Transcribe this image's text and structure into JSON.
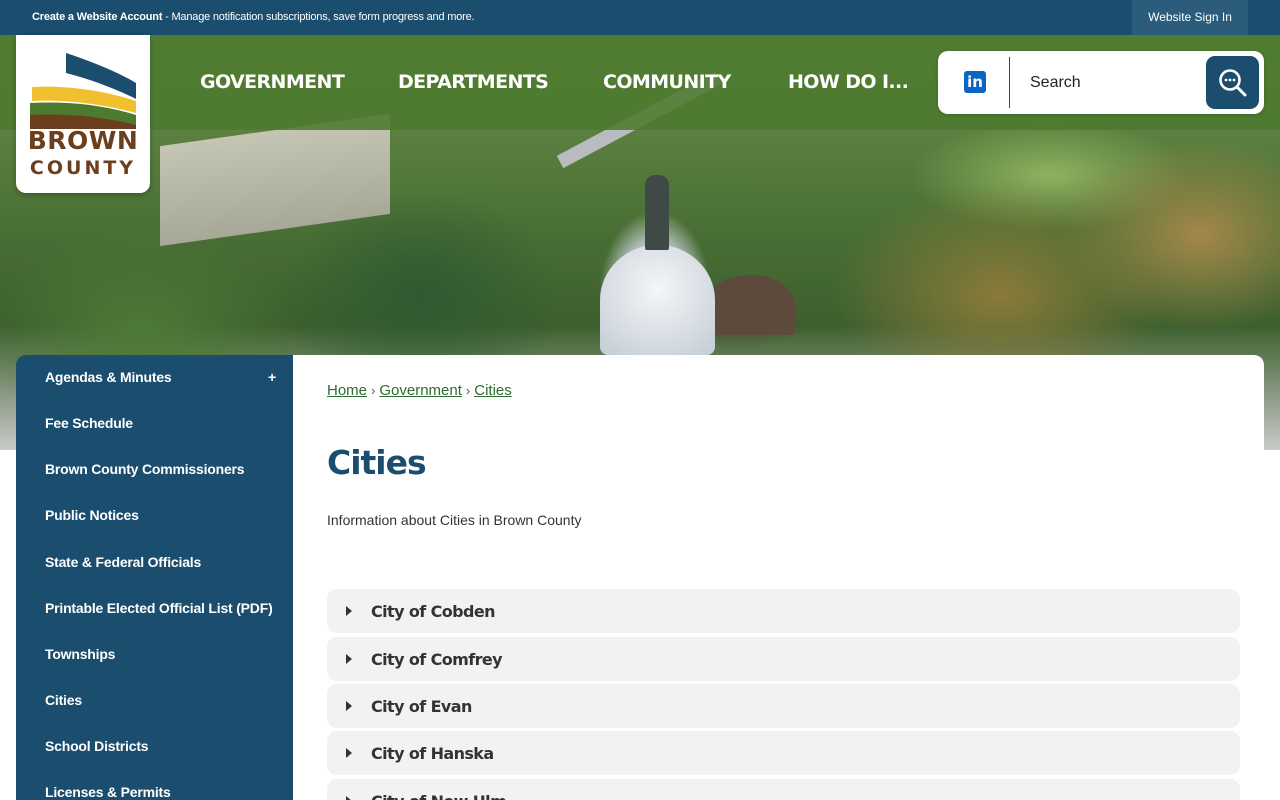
{
  "topbar": {
    "create_account": "Create a Website Account",
    "message": " - Manage notification subscriptions, save form progress and more.",
    "signin_label": "Website Sign In"
  },
  "logo": {
    "line1": "BROWN",
    "line2": "COUNTY",
    "colors": {
      "navy": "#1a4d6e",
      "gold": "#f0c030",
      "green": "#4c7a2f",
      "brown": "#6b3f1d"
    }
  },
  "nav": {
    "items": [
      {
        "label": "GOVERNMENT"
      },
      {
        "label": "DEPARTMENTS"
      },
      {
        "label": "COMMUNITY"
      },
      {
        "label": "HOW DO I..."
      }
    ]
  },
  "search": {
    "placeholder": "Search",
    "social_icon": "linkedin-icon",
    "button_icon": "search-icon"
  },
  "sidebar": {
    "items": [
      {
        "label": "Agendas & Minutes",
        "expand": "+"
      },
      {
        "label": "Fee Schedule"
      },
      {
        "label": "Brown County Commissioners"
      },
      {
        "label": "Public Notices"
      },
      {
        "label": "State & Federal Officials"
      },
      {
        "label": "Printable Elected Official List (PDF)"
      },
      {
        "label": "Townships"
      },
      {
        "label": "Cities"
      },
      {
        "label": "School Districts"
      },
      {
        "label": "Licenses & Permits"
      }
    ]
  },
  "breadcrumb": {
    "items": [
      "Home",
      "Government",
      "Cities"
    ],
    "separator": "›"
  },
  "main": {
    "title": "Cities",
    "intro": "Information about Cities in Brown County",
    "accordions": [
      {
        "label": "City of Cobden"
      },
      {
        "label": "City of Comfrey"
      },
      {
        "label": "City of Evan"
      },
      {
        "label": "City of Hanska"
      },
      {
        "label": "City of New Ulm"
      }
    ]
  },
  "theme": {
    "primary": "#1a4d6e",
    "nav_green": "#4c7a2f",
    "link_green": "#2e6b2f",
    "accordion_bg": "#f2f2f2"
  }
}
